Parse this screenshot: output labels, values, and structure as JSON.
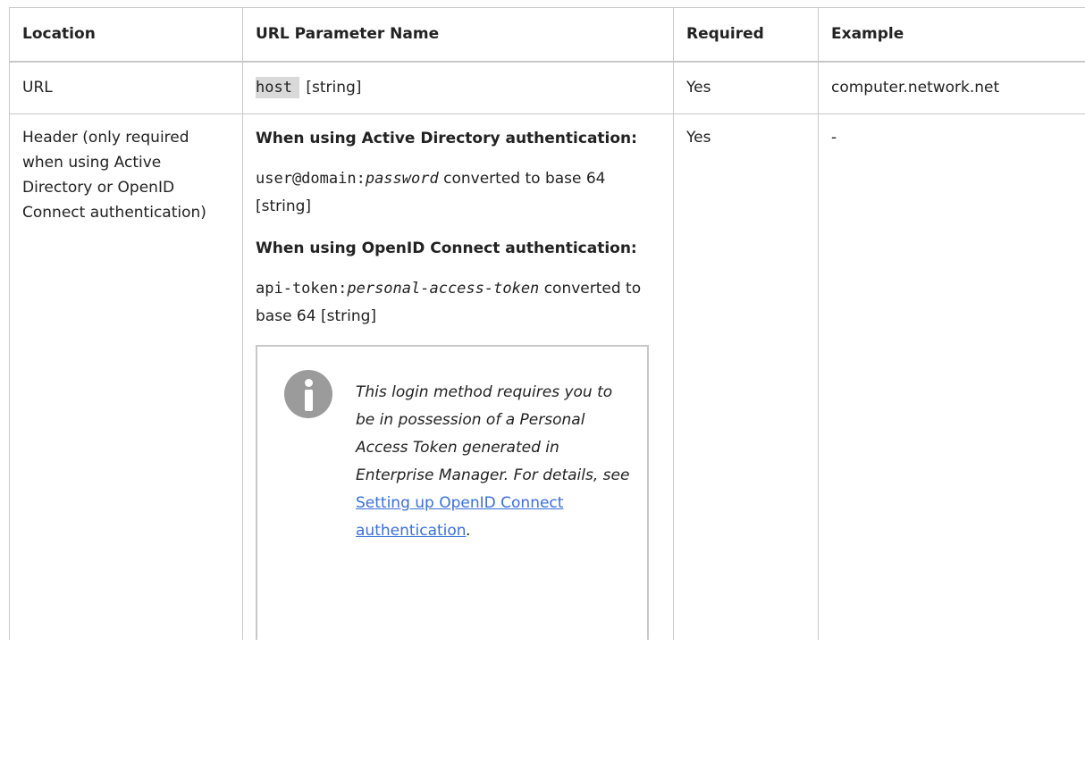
{
  "table": {
    "headers": {
      "location": "Location",
      "param_name": "URL Parameter Name",
      "required": "Required",
      "example": "Example"
    },
    "rows": [
      {
        "location": "URL",
        "param_code": "host",
        "param_type": "[string]",
        "required": "Yes",
        "example": "computer.network.net"
      },
      {
        "location": "Header (only required when using Active Directory or OpenID Connect authentication)",
        "ad_heading": "When using Active Directory authentication:",
        "ad_code_plain": "user@domain:",
        "ad_code_italic": "password",
        "ad_suffix": " converted to base 64 [string]",
        "oidc_heading": "When using OpenID Connect authentication:",
        "oidc_code_plain": "api-token:",
        "oidc_code_italic": "personal-access-token",
        "oidc_suffix": " converted to base 64 [string]",
        "note_text": "This login method requires you to be in possession of a Personal Access Token generated in Enterprise Manager. For details, see ",
        "note_link": "Setting up OpenID Connect authentication",
        "note_end": ".",
        "required": "Yes",
        "example": "-"
      }
    ]
  },
  "icons": {
    "note": "info-icon"
  }
}
